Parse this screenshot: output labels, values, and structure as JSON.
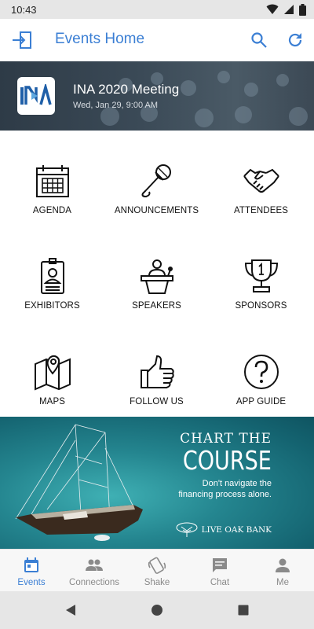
{
  "status_bar": {
    "time": "10:43"
  },
  "app_bar": {
    "title": "Events Home"
  },
  "event": {
    "logo_text": "INA",
    "name": "INA 2020 Meeting",
    "date": "Wed, Jan 29, 9:00 AM"
  },
  "tiles": [
    {
      "label": "AGENDA",
      "icon": "calendar-icon"
    },
    {
      "label": "ANNOUNCEMENTS",
      "icon": "microphone-icon"
    },
    {
      "label": "ATTENDEES",
      "icon": "handshake-icon"
    },
    {
      "label": "EXHIBITORS",
      "icon": "id-badge-icon"
    },
    {
      "label": "SPEAKERS",
      "icon": "podium-icon"
    },
    {
      "label": "SPONSORS",
      "icon": "trophy-icon"
    },
    {
      "label": "MAPS",
      "icon": "map-icon"
    },
    {
      "label": "FOLLOW US",
      "icon": "thumbs-up-icon"
    },
    {
      "label": "APP GUIDE",
      "icon": "question-icon"
    }
  ],
  "ad": {
    "line1": "CHART THE",
    "line2": "COURSE",
    "line3a": "Don't navigate the",
    "line3b": "financing process alone.",
    "brand": "LIVE OAK BANK"
  },
  "bottom_nav": [
    {
      "label": "Events",
      "icon": "calendar-icon",
      "active": true
    },
    {
      "label": "Connections",
      "icon": "people-icon",
      "active": false
    },
    {
      "label": "Shake",
      "icon": "shake-phone-icon",
      "active": false
    },
    {
      "label": "Chat",
      "icon": "chat-icon",
      "active": false
    },
    {
      "label": "Me",
      "icon": "person-icon",
      "active": false
    }
  ],
  "colors": {
    "accent": "#3b7fd4",
    "inactive": "#8a8a8a"
  }
}
